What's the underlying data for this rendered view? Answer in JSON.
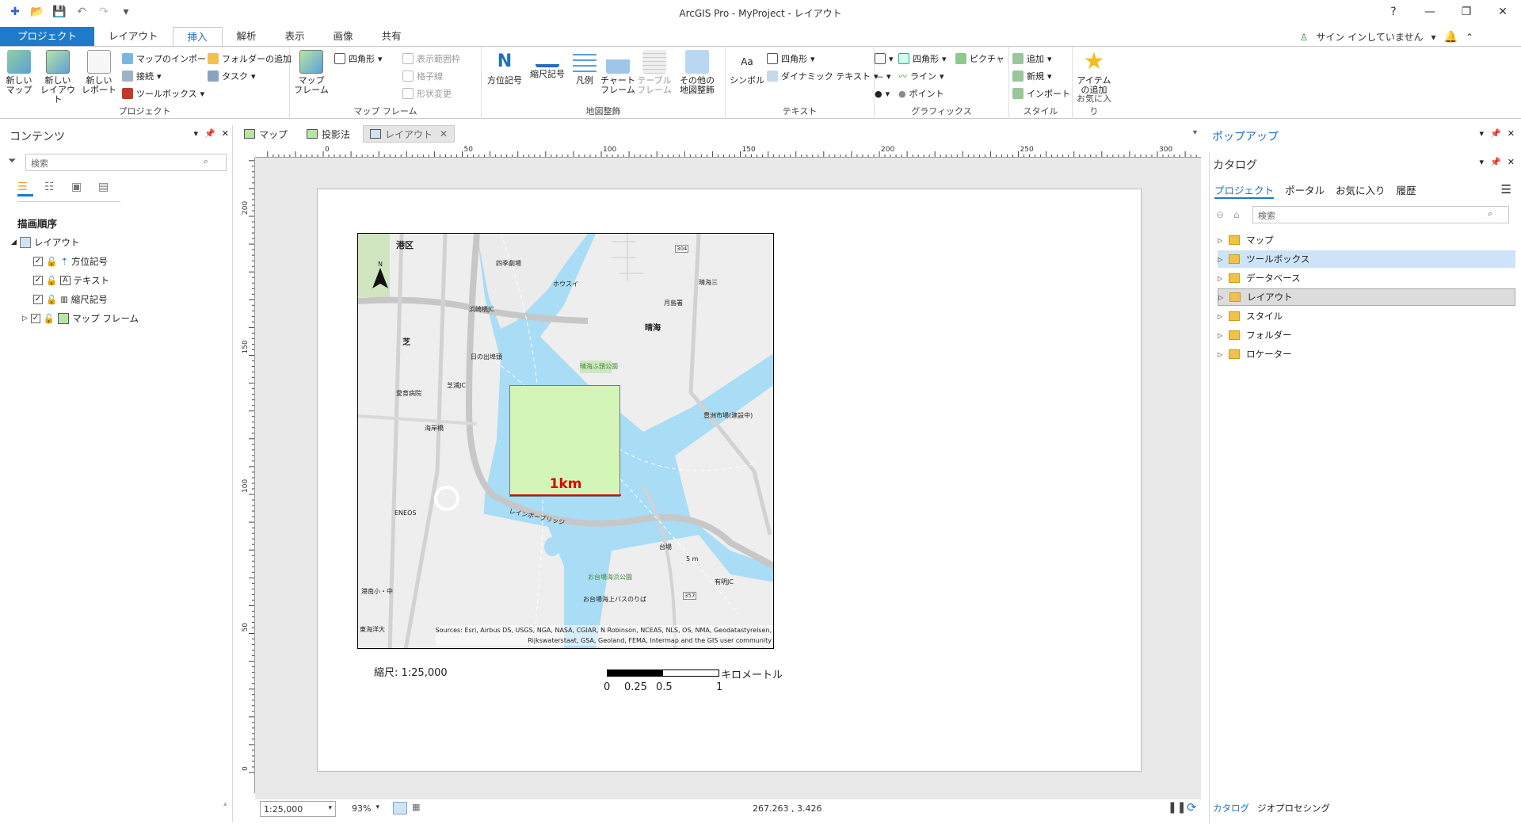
{
  "window": {
    "title": "ArcGIS Pro - MyProject - レイアウト",
    "help": "?"
  },
  "ribbon_tabs": [
    "プロジェクト",
    "レイアウト",
    "挿入",
    "解析",
    "表示",
    "画像",
    "共有"
  ],
  "signin": "サイン インしていません",
  "ribbon": {
    "project_group": {
      "label": "プロジェクト",
      "new_map": "新しい\nマップ",
      "new_layout": "新しい\nレイアウト",
      "new_report": "新しい\nレポート",
      "import_map": "マップのインポート",
      "connect": "接続",
      "toolbox": "ツールボックス",
      "add_folder": "フォルダーの追加",
      "task": "タスク"
    },
    "mapframe_group": {
      "label": "マップ フレーム",
      "map_frame": "マップ\nフレーム",
      "rectangle": "四角形",
      "extent_indicator": "表示範囲枠",
      "grid": "格子線",
      "reshape": "形状変更"
    },
    "surround_group": {
      "label": "地図整飾",
      "north_arrow": "方位記号",
      "scale_bar": "縮尺記号",
      "legend": "凡例",
      "chart_frame": "チャート\nフレーム",
      "table_frame": "テーブル\nフレーム",
      "other": "その他の\n地図整飾"
    },
    "text_group": {
      "label": "テキスト",
      "symbol": "シンボル",
      "rectangle": "四角形",
      "dynamic_text": "ダイナミック テキスト"
    },
    "graphics_group": {
      "label": "グラフィックス",
      "rectangle": "四角形",
      "picture": "ピクチャ",
      "line": "ライン",
      "point": "ポイント"
    },
    "style_group": {
      "label": "スタイル",
      "add": "追加",
      "new": "新規",
      "import": "インポート"
    },
    "favorites_group": {
      "label": "お気に入り",
      "add_item": "アイテム\nの追加"
    }
  },
  "contents": {
    "title": "コンテンツ",
    "search_placeholder": "検索",
    "draw_order": "描画順序",
    "root": "レイアウト",
    "items": [
      "方位記号",
      "テキスト",
      "縮尺記号",
      "マップ フレーム"
    ]
  },
  "doc_tabs": [
    "マップ",
    "投影法",
    "レイアウト"
  ],
  "rulers": {
    "h": [
      "0",
      "50",
      "100",
      "150",
      "200",
      "250",
      "300"
    ],
    "v": [
      "200",
      "150",
      "100",
      "50",
      "0"
    ]
  },
  "layout": {
    "scale_text": "縮尺: 1:25,000",
    "scalebar_unit": "キロメートル",
    "scalebar_ticks": [
      "0",
      "0.25",
      "0.5",
      "1"
    ],
    "box_label": "1km",
    "attribution": "Sources: Esri, Airbus DS, USGS, NGA, NASA, CGIAR, N Robinson, NCEAS, NLS, OS, NMA, Geodatastyrelsen,\nRijkswaterstaat, GSA, Geoland, FEMA, Intermap and the GIS user community",
    "map_labels": [
      "港区",
      "四季劇場",
      "ホウスイ",
      "晴海三",
      "月島署",
      "晴海",
      "芝",
      "浜崎橋JC",
      "日の出埠頭",
      "晴海ふ頭公園",
      "芝浦JC",
      "愛育病院",
      "豊洲市場(建設中)",
      "海岸橋",
      "ENEOS",
      "レインボーブリッジ",
      "台場",
      "有明JC",
      "お台場海浜公園",
      "お台場海上バスのりば",
      "港南小・中",
      "東海洋大",
      "5 m",
      "304",
      "357"
    ]
  },
  "status": {
    "scale": "1:25,000",
    "zoom": "93%",
    "coords": "267.263 , 3.426"
  },
  "popup": {
    "title": "ポップアップ"
  },
  "catalog": {
    "title": "カタログ",
    "tabs": [
      "プロジェクト",
      "ポータル",
      "お気に入り",
      "履歴"
    ],
    "search_placeholder": "検索",
    "items": [
      "マップ",
      "ツールボックス",
      "データベース",
      "レイアウト",
      "スタイル",
      "フォルダー",
      "ロケーター"
    ],
    "bottom_tabs": [
      "カタログ",
      "ジオプロセシング"
    ]
  },
  "colors": {
    "accent": "#1e7acb",
    "water": "#a9dcf5",
    "land": "#eeeeee",
    "box_fill": "#d3f5b8",
    "box_text": "#e00000",
    "park": "#cfe6c0"
  }
}
